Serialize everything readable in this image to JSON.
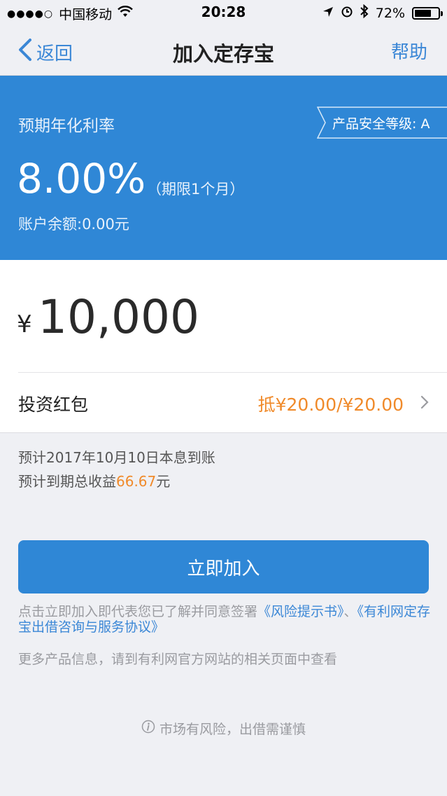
{
  "status_bar": {
    "carrier": "中国移动",
    "time": "20:28",
    "battery": "72%",
    "battery_level": 0.72
  },
  "nav": {
    "back_label": "返回",
    "title": "加入定存宝",
    "help_label": "帮助"
  },
  "hero": {
    "rate_label": "预期年化利率",
    "safety_label": "产品安全等级: A",
    "rate_value": "8.00%",
    "term": "（期限1个月）",
    "balance": "账户余额:0.00元"
  },
  "amount": {
    "currency": "¥",
    "value": "10,000"
  },
  "coupon": {
    "label": "投资红包",
    "value": "抵¥20.00/¥20.00"
  },
  "estimates": {
    "arrival": "预计2017年10月10日本息到账",
    "income_prefix": "预计到期总收益",
    "income_value": "66.67",
    "income_suffix": "元"
  },
  "join_button": "立即加入",
  "agreement": {
    "prefix": "点击立即加入即代表您已了解并同意签署",
    "link1": "《风险提示书》",
    "separator": "、",
    "link2": "《有利网定存宝出借咨询与服务协议》"
  },
  "more_info": "更多产品信息，请到有利网官方网站的相关页面中查看",
  "risk_notice": "市场有风险，出借需谨慎"
}
